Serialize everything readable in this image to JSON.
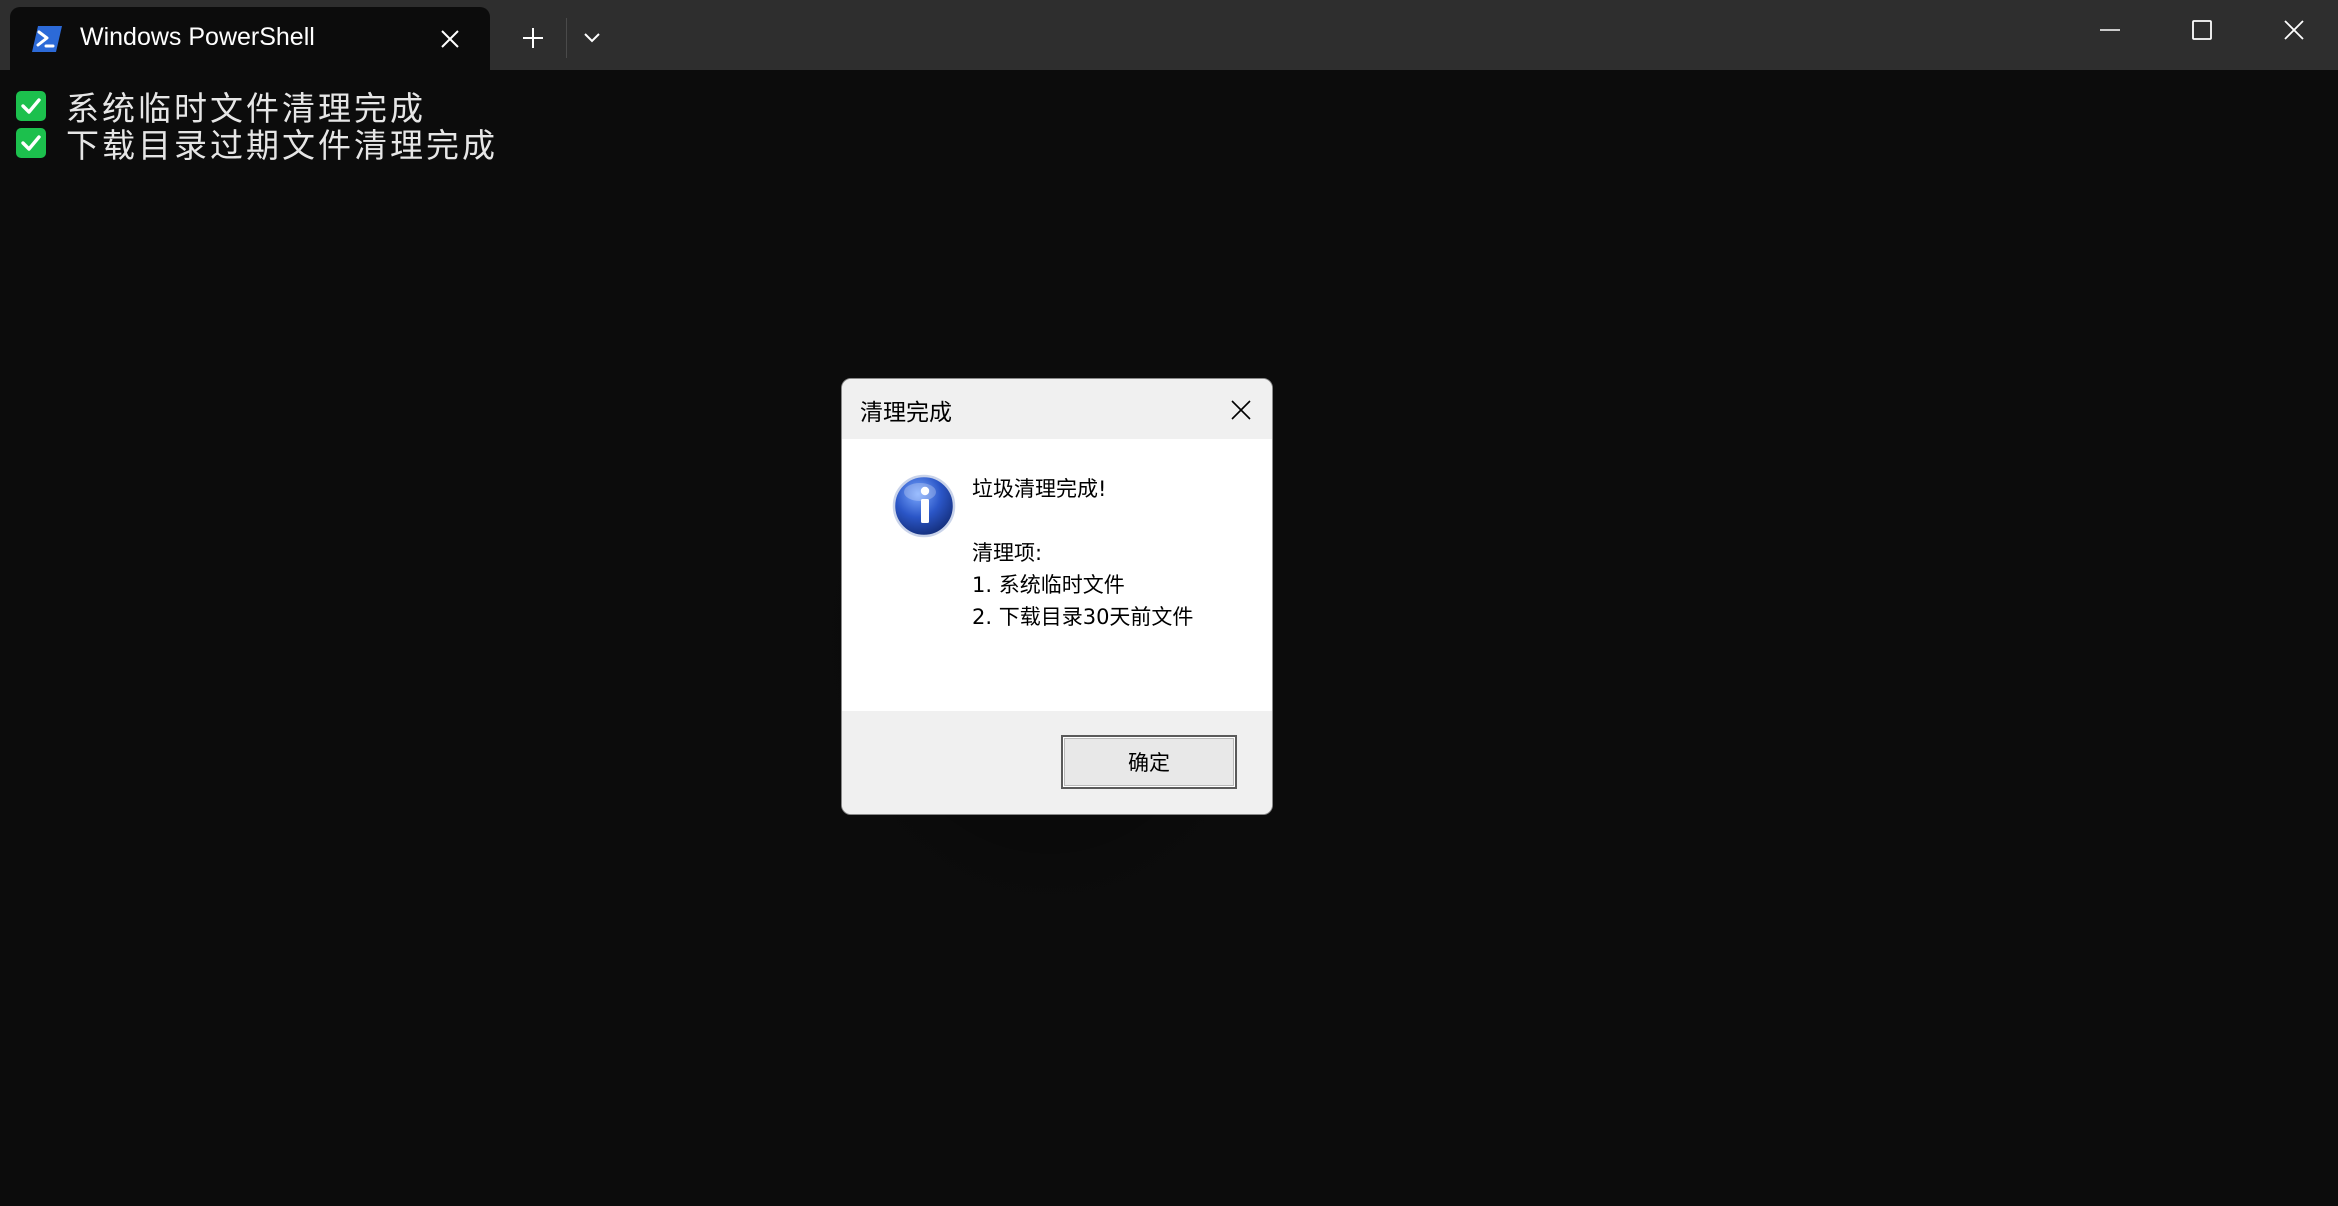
{
  "window": {
    "tab_title": "Windows PowerShell",
    "tab_icon": "powershell-icon",
    "new_tab_icon": "plus-icon",
    "dropdown_icon": "chevron-down-icon",
    "caption_buttons": [
      "minimize-icon",
      "maximize-icon",
      "close-icon"
    ]
  },
  "terminal": {
    "lines": [
      {
        "icon": "check-mark-icon",
        "text": "系统临时文件清理完成"
      },
      {
        "icon": "check-mark-icon",
        "text": "下载目录过期文件清理完成"
      }
    ],
    "check_color": "#1cc04d"
  },
  "dialog": {
    "title": "清理完成",
    "icon": "info-icon",
    "message": {
      "headline": "垃圾清理完成!",
      "list_title": "清理项:",
      "items": [
        "1. 系统临时文件",
        "2. 下载目录30天前文件"
      ]
    },
    "ok_label": "确定"
  }
}
